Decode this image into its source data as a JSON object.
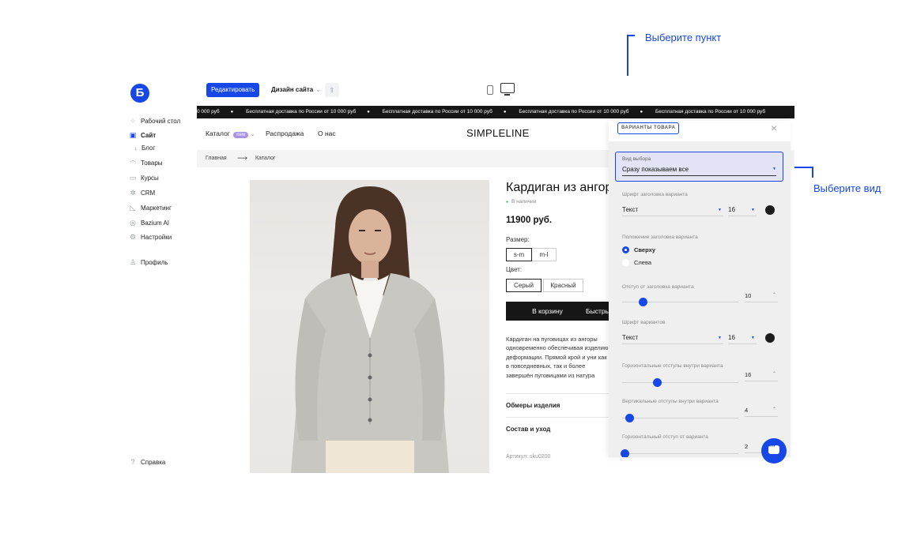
{
  "sidebar": {
    "items": [
      {
        "label": "Рабочий стол",
        "icon": "dashboard-icon"
      },
      {
        "label": "Сайт",
        "icon": "site-icon"
      },
      {
        "label": "Блог",
        "icon": "sub-arrow-icon"
      },
      {
        "label": "Товары",
        "icon": "bag-icon"
      },
      {
        "label": "Курсы",
        "icon": "courses-icon"
      },
      {
        "label": "CRM",
        "icon": "crm-icon"
      },
      {
        "label": "Маркетинг",
        "icon": "marketing-icon"
      },
      {
        "label": "Bazium AI",
        "icon": "ai-icon"
      },
      {
        "label": "Настройки",
        "icon": "gear-icon"
      }
    ],
    "profile": "Профиль",
    "help": "Справка",
    "logo": "Б"
  },
  "topbar": {
    "edit_label": "Редактировать",
    "design_label": "Дизайн сайта"
  },
  "store": {
    "ticker": "Бесплатная доставка по России от 10 000 руб",
    "ticker_first": "0 000 руб",
    "nav": {
      "catalog": "Каталог",
      "new_badge": "new",
      "sale": "Распродажа",
      "about": "О нас"
    },
    "brand": "SIMPLELINE",
    "breadcrumb": {
      "home": "Главная",
      "arrow": "⟶",
      "current": "Каталог"
    },
    "product": {
      "title": "Кардиган из ангоры",
      "stock": "В наличии",
      "price": "11900 руб.",
      "size_label": "Размер:",
      "sizes": [
        "s-m",
        "m-l"
      ],
      "color_label": "Цвет:",
      "colors": [
        "Серый",
        "Красный"
      ],
      "cart": "В корзину",
      "quick": "Быстрый заказ",
      "description": "Кардиган на пуговицах из ангоры одновременно обеспечивая изделию деформации. Прямой крой и уни как в повседневных, так и более завершён пуговицами из натура",
      "accordion": [
        "Обмеры изделия",
        "Состав и уход"
      ],
      "sku": "Артикул: sku0200"
    }
  },
  "panel": {
    "tag": "ВАРИАНТЫ ТОВАРА",
    "close": "×",
    "select_label": "Вид выбора",
    "select_value": "Сразу показываем все",
    "font_title_label": "Шрифт заголовка варианта",
    "font_title_value": "Текст",
    "font_title_size": "16",
    "position_label": "Положение заголовка варианта",
    "position_options": [
      "Сверху",
      "Слева"
    ],
    "offset_label": "Отступ от заголовка варианта",
    "offset_value": "10",
    "font_variants_label": "Шрифт вариантов",
    "font_variants_value": "Текст",
    "font_variants_size": "16",
    "h_pad_label": "Горизонтальные отступы внутри варианта",
    "h_pad_value": "16",
    "v_pad_label": "Вертикальные отступы внутри варианта",
    "v_pad_value": "4",
    "h_gap_label": "Горизонтальный отступ от варианта",
    "h_gap_value": "2",
    "swatch_color": "#1d1d1d",
    "accent": "#1747e6"
  },
  "callouts": {
    "top": "Выберите пункт",
    "right": "Выберите вид"
  }
}
